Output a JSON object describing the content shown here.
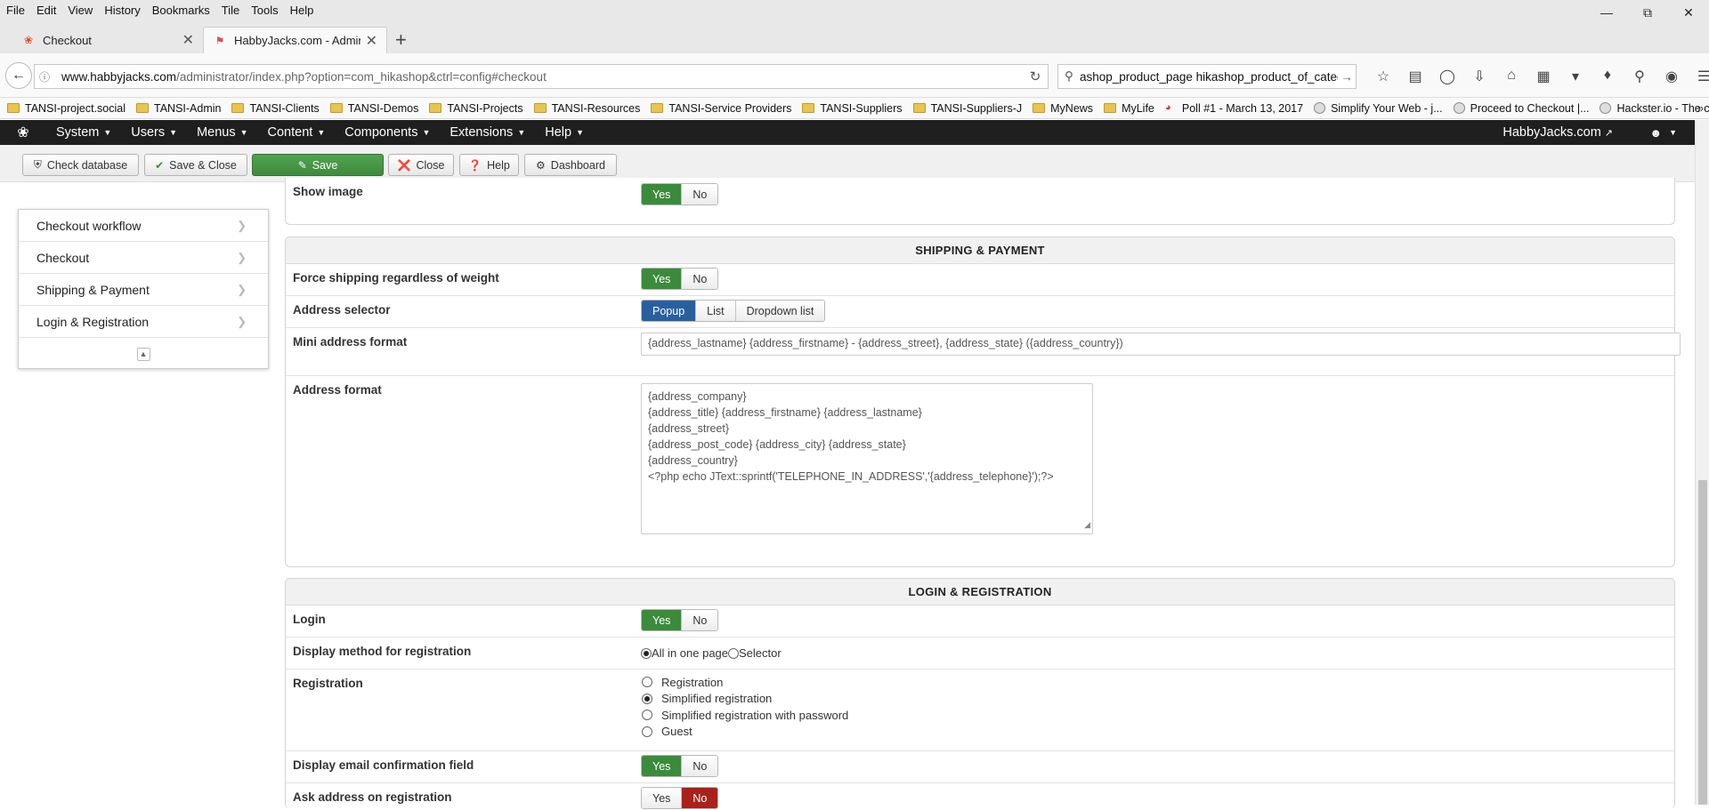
{
  "browser": {
    "menu": [
      "File",
      "Edit",
      "View",
      "History",
      "Bookmarks",
      "Tile",
      "Tools",
      "Help"
    ],
    "tabs": [
      {
        "title": "Checkout",
        "icon": "joomla-icon"
      },
      {
        "title": "HabbyJacks.com - Admini...",
        "icon": "hikashop-icon"
      }
    ],
    "url_host": "www.habbyjacks.com",
    "url_path": "/administrator/index.php?option=com_hikashop&ctrl=config#checkout",
    "search_text": "ashop_product_page hikashop_product_of_categ",
    "bookmarks": [
      {
        "label": "TANSI-project.social",
        "icon": "folder"
      },
      {
        "label": "TANSI-Admin",
        "icon": "folder"
      },
      {
        "label": "TANSI-Clients",
        "icon": "folder"
      },
      {
        "label": "TANSI-Demos",
        "icon": "folder"
      },
      {
        "label": "TANSI-Projects",
        "icon": "folder"
      },
      {
        "label": "TANSI-Resources",
        "icon": "folder"
      },
      {
        "label": "TANSI-Service Providers",
        "icon": "folder"
      },
      {
        "label": "TANSI-Suppliers",
        "icon": "folder"
      },
      {
        "label": "TANSI-Suppliers-J",
        "icon": "folder"
      },
      {
        "label": "MyNews",
        "icon": "folder"
      },
      {
        "label": "MyLife",
        "icon": "folder"
      },
      {
        "label": "Poll #1 - March 13, 2017",
        "icon": "poll"
      },
      {
        "label": "Simplify Your Web - j...",
        "icon": "globe"
      },
      {
        "label": "Proceed to Checkout |...",
        "icon": "globe"
      },
      {
        "label": "Hackster.io - The com...",
        "icon": "globe"
      }
    ]
  },
  "admin": {
    "menus": [
      "System",
      "Users",
      "Menus",
      "Content",
      "Components",
      "Extensions",
      "Help"
    ],
    "site_name": "HabbyJacks.com",
    "toolbar": {
      "check_db": "Check database",
      "save_close": "Save & Close",
      "save": "Save",
      "close": "Close",
      "help": "Help",
      "dashboard": "Dashboard"
    }
  },
  "leftnav": [
    "Checkout workflow",
    "Checkout",
    "Shipping & Payment",
    "Login & Registration"
  ],
  "top_row": {
    "label": "Show image",
    "yes": "Yes",
    "no": "No"
  },
  "shipping": {
    "header": "SHIPPING & PAYMENT",
    "force_label": "Force shipping regardless of weight",
    "address_selector_label": "Address selector",
    "selector_opts": [
      "Popup",
      "List",
      "Dropdown list"
    ],
    "mini_label": "Mini address format",
    "mini_value": "{address_lastname} {address_firstname} - {address_street}, {address_state} ({address_country})",
    "format_label": "Address format",
    "format_value": "{address_company}\n{address_title} {address_firstname} {address_lastname}\n{address_street}\n{address_post_code} {address_city} {address_state}\n{address_country}\n<?php echo JText::sprintf('TELEPHONE_IN_ADDRESS','{address_telephone}');?>"
  },
  "login": {
    "header": "LOGIN & REGISTRATION",
    "login_label": "Login",
    "display_method_label": "Display method for registration",
    "display_opts": [
      "All in one page",
      "Selector"
    ],
    "registration_label": "Registration",
    "registration_opts": [
      "Registration",
      "Simplified registration",
      "Simplified registration with password",
      "Guest"
    ],
    "email_confirm_label": "Display email confirmation field",
    "ask_address_label": "Ask address on registration"
  },
  "yes": "Yes",
  "no": "No",
  "colors": {
    "yes_green": "#3c8a3c",
    "popup_blue": "#2a5f9e",
    "no_red": "#a8221b"
  }
}
